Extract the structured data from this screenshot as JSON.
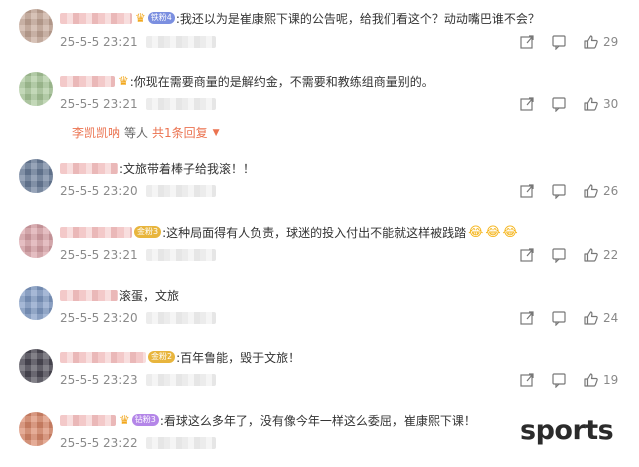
{
  "comments": [
    {
      "text": ":我还以为是崔康熙下课的公告呢，给我们看这个？动动嘴巴谁不会？",
      "badge": "铁粉4",
      "badge_color": "#7b8fe0",
      "time": "25-5-5 23:21",
      "likes": "29",
      "avatar_color": "#c5a898"
    },
    {
      "text": ":你现在需要商量的是解约金，不需要和教练组商量别的。",
      "badge": "",
      "badge_color": "",
      "time": "25-5-5 23:21",
      "likes": "30",
      "avatar_color": "#a9c89a",
      "replies": {
        "user": "李凯凯呐",
        "middle": "等人",
        "count": "共1条回复"
      }
    },
    {
      "text": ":文旅带着棒子给我滚！！",
      "badge": "",
      "badge_color": "",
      "time": "25-5-5 23:20",
      "likes": "26",
      "avatar_color": "#6a7d9a"
    },
    {
      "text": ":这种局面得有人负责，球迷的投入付出不能就这样被践踏",
      "badge": "金粉3",
      "badge_color": "#e8b53d",
      "time": "25-5-5 23:21",
      "likes": "22",
      "avatar_color": "#d9a2a8",
      "emojis": [
        "😂",
        "😂",
        "😂"
      ]
    },
    {
      "text": "滚蛋，文旅",
      "badge": "",
      "badge_color": "",
      "time": "25-5-5 23:20",
      "likes": "24",
      "avatar_color": "#7f9ac4"
    },
    {
      "text": ":百年鲁能，毁于文旅！",
      "badge": "金粉2",
      "badge_color": "#e8b53d",
      "time": "25-5-5 23:23",
      "likes": "19",
      "avatar_color": "#4c4a55"
    },
    {
      "text": ":看球这么多年了，没有像今年一样这么委屈，崔康熙下课！",
      "badge": "钻粉3",
      "badge_color": "#b486e8",
      "time": "25-5-5 23:22",
      "likes": "",
      "avatar_color": "#d9886a"
    }
  ],
  "icons": {
    "share": "share-icon",
    "comment": "comment-icon",
    "like": "thumbs-up-icon"
  },
  "colors": {
    "accent": "#eb7350",
    "meta": "#8a8a8a",
    "text": "#333333"
  },
  "watermark": "sports"
}
